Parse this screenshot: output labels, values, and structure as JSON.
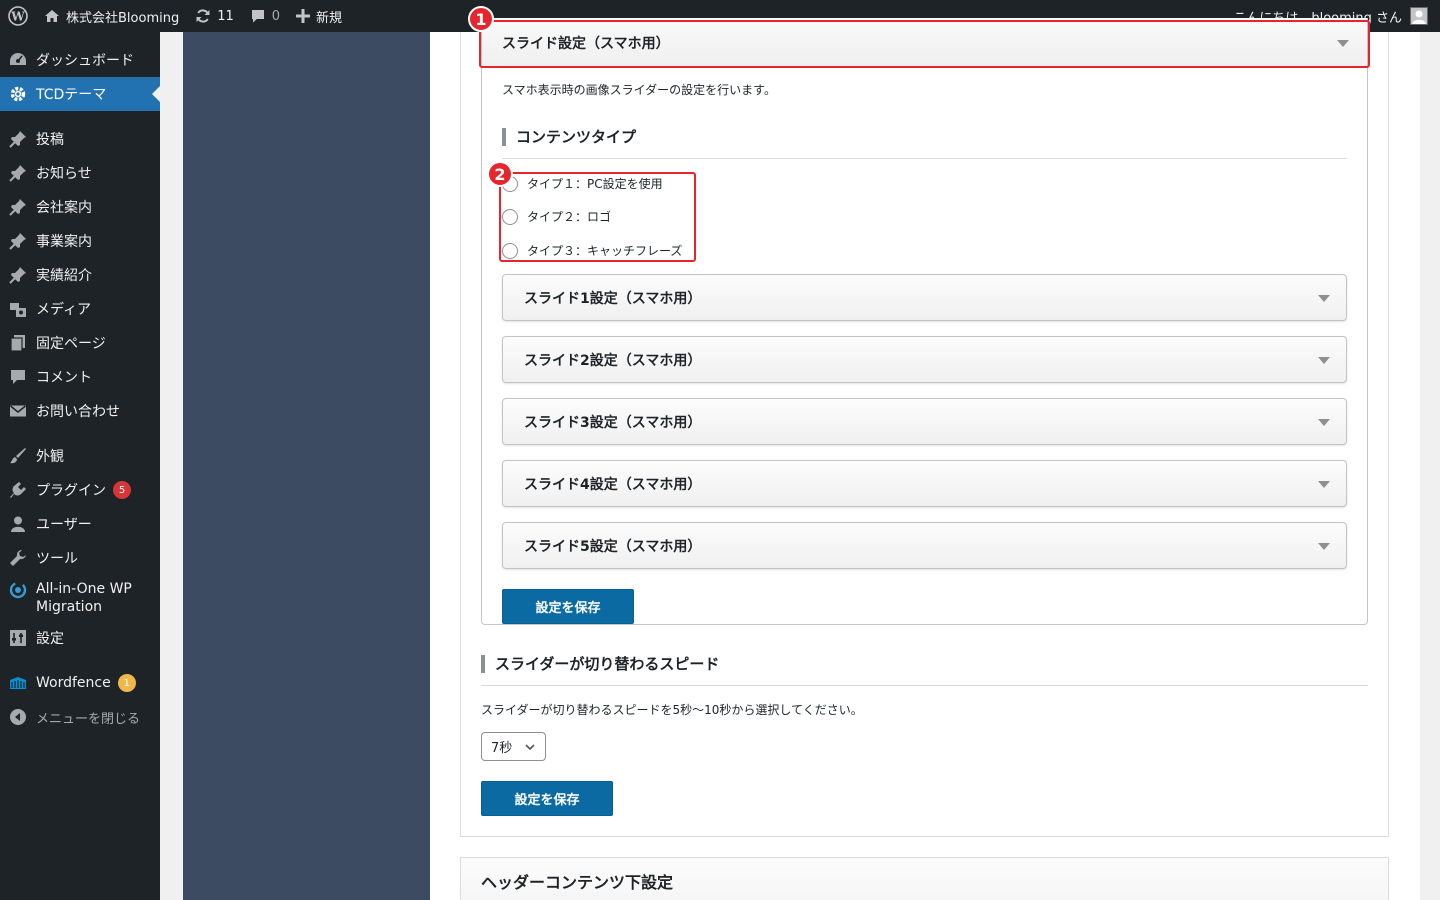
{
  "adminbar": {
    "site_name": "株式会社Blooming",
    "updates_count": "11",
    "comments_count": "0",
    "new_label": "新規",
    "greeting": "こんにちは、blooming さん"
  },
  "sidebar": {
    "items": [
      {
        "label": "ダッシュボード",
        "icon": "dashboard-icon"
      },
      {
        "label": "TCDテーマ",
        "icon": "gear-icon"
      },
      {
        "label": "投稿",
        "icon": "pin-icon"
      },
      {
        "label": "お知らせ",
        "icon": "pin-icon"
      },
      {
        "label": "会社案内",
        "icon": "pin-icon"
      },
      {
        "label": "事業案内",
        "icon": "pin-icon"
      },
      {
        "label": "実績紹介",
        "icon": "pin-icon"
      },
      {
        "label": "メディア",
        "icon": "media-icon"
      },
      {
        "label": "固定ページ",
        "icon": "page-icon"
      },
      {
        "label": "コメント",
        "icon": "comment-icon"
      },
      {
        "label": "お問い合わせ",
        "icon": "mail-icon"
      },
      {
        "label": "外観",
        "icon": "brush-icon"
      },
      {
        "label": "プラグイン",
        "icon": "plugin-icon",
        "badge": "5"
      },
      {
        "label": "ユーザー",
        "icon": "user-icon"
      },
      {
        "label": "ツール",
        "icon": "wrench-icon"
      },
      {
        "label": "All-in-One WP",
        "label2": "Migration",
        "icon": "migration-icon"
      },
      {
        "label": "設定",
        "icon": "settings-icon"
      },
      {
        "label": "Wordfence",
        "icon": "wordfence-icon",
        "badge": "1"
      },
      {
        "label": "メニューを閉じる",
        "icon": "collapse-icon"
      }
    ]
  },
  "slider_sp": {
    "title": "スライド設定（スマホ用）",
    "description": "スマホ表示時の画像スライダーの設定を行います。",
    "content_type_heading": "コンテンツタイプ",
    "options": [
      "タイプ１：PC設定を使用",
      "タイプ２：ロゴ",
      "タイプ３：キャッチフレーズ"
    ],
    "slides": [
      "スライド1設定（スマホ用）",
      "スライド2設定（スマホ用）",
      "スライド3設定（スマホ用）",
      "スライド4設定（スマホ用）",
      "スライド5設定（スマホ用）"
    ],
    "save_label": "設定を保存"
  },
  "speed": {
    "heading": "スライダーが切り替わるスピード",
    "description": "スライダーが切り替わるスピードを5秒〜10秒から選択してください。",
    "selected": "7秒",
    "save_label": "設定を保存"
  },
  "next_section_title": "ヘッダーコンテンツ下設定",
  "annotations": [
    "1",
    "2"
  ],
  "colors": {
    "admin_dark": "#1d2327",
    "accent_blue": "#2271b1",
    "button_blue": "#0a6aa1",
    "annotation_red": "#e5262e",
    "theme_nav": "#3c4b62"
  }
}
